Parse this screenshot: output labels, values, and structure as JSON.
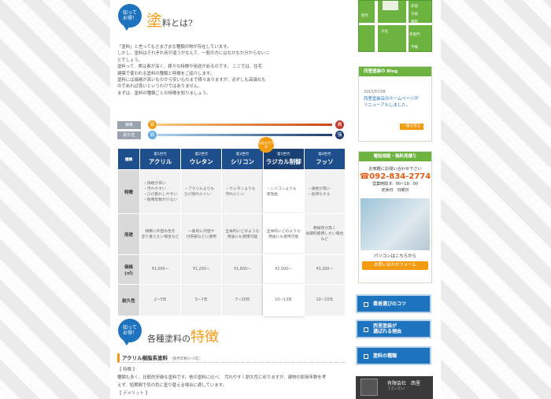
{
  "badge1": {
    "l1": "知って",
    "l2": "お得！"
  },
  "heading1": {
    "big": "塗",
    "rest": "料とは?"
  },
  "intro": [
    "「塗料」と言ってもさまざまな種類の物が存在しています。",
    "しかし、塗料はそれぞれ何が違うかなんて、一般の方にはなかなか分からないこ",
    "とでしょう。",
    "塗料って、実は奥が深く、様々な特徴や用途があるのです。 ここでは、住宅",
    "建築で使われる塗料の種類と特徴をご紹介します。",
    "塗料には価格が高いものから安いものまで様々ありますが、必ずしも高価なも",
    "のであれば良いというわけではありません。",
    "まずは、塗料の種類ごとの特徴を知りましょう。"
  ],
  "legend": [
    {
      "tag": "価格",
      "start": "安",
      "end": "高"
    },
    {
      "tag": "耐久性",
      "start": "弱",
      "end": "強"
    }
  ],
  "recommend": "当社おすすめ",
  "table": {
    "corner": "種類",
    "columns": [
      {
        "gen": "第1世代",
        "name": "アクリル"
      },
      {
        "gen": "第2世代",
        "name": "ウレタン"
      },
      {
        "gen": "第3世代",
        "name": "シリコン"
      },
      {
        "gen": "第5世代",
        "name": "ラジカル制御"
      },
      {
        "gen": "第4世代",
        "name": "フッソ"
      }
    ],
    "rows": [
      {
        "label": "特徴",
        "cells": [
          "・価格が安い\n・汚れやすい\n・ひび割れしやすい\n・耐用年数が少ない",
          "・アクリルよりも\nひび割れにくい",
          "・ウレタンよりも\n汚れにくい",
          "・シリコンよりも\n高性能",
          "・価格が高い\n・長持ちする"
        ]
      },
      {
        "label": "用途",
        "cells": [
          "頻繁に外壁の色を\n塗り替えたい場合など",
          "一般的に外壁や\n付帯部などに使用",
          "全体的にどのような\n用途にも使用可能",
          "全体的にどのような\n用途にも使用可能",
          "耐候性が高く\n長期的使用したい場合など"
        ]
      },
      {
        "label": "価格\n(㎡)",
        "cells": [
          "¥1,000〜",
          "¥1,200〜",
          "¥1,800〜",
          "¥2,500〜",
          "¥3,200〜"
        ]
      },
      {
        "label": "耐久性",
        "cells": [
          "2〜5年",
          "5〜7年",
          "7〜10年",
          "10〜13年",
          "10〜15年"
        ]
      }
    ]
  },
  "badge2": {
    "l1": "知って",
    "l2": "お得！"
  },
  "heading2": {
    "rest": "各種塗料の",
    "big": "特徴"
  },
  "subheading": {
    "title": "アクリル樹脂系塗料",
    "note": "（耐用年数3〜5年）"
  },
  "body2": [
    "【 特徴 】",
    "種類も多く、比較的安価な塗料です。他の塗料に比べ、 汚れやすく耐久性に劣りますが、建物の耐用年数を考",
    "えず、短期間で気の色に塗り替える場合に適しています。",
    "【 デメリット 】"
  ],
  "map_labels": [
    "昭代",
    "赤坂",
    "今泉",
    "薬院",
    "大名",
    "赤坂門",
    "平尾"
  ],
  "blog": {
    "title": "西里塗装の Blog",
    "date": "2015/07/08",
    "text": [
      "西里塗装店のホームページが",
      "リニューアルしました。"
    ],
    "more": "一覧を見る"
  },
  "tel": {
    "title": "電話相談・無料見積り",
    "lead": "お気軽にお問い合わせ下さい",
    "number": "092-834-2774",
    "hours": "営業時間 8：00~19：00",
    "holiday": "定休日　日曜日",
    "pc": "パソコンはこちらから",
    "mail": "お問い合わせフォーム"
  },
  "nav": [
    {
      "label": "業者選びのコツ"
    },
    {
      "label": "西里塗装が\n選ばれる理由"
    },
    {
      "label": "塗料の種類"
    }
  ],
  "company": {
    "name": "有限会社　西里",
    "sub": "うえいたい"
  },
  "colors": {
    "accent": "#f39c12",
    "blue": "#1e73be",
    "navy": "#1e4f8c",
    "green": "#6db33f"
  }
}
